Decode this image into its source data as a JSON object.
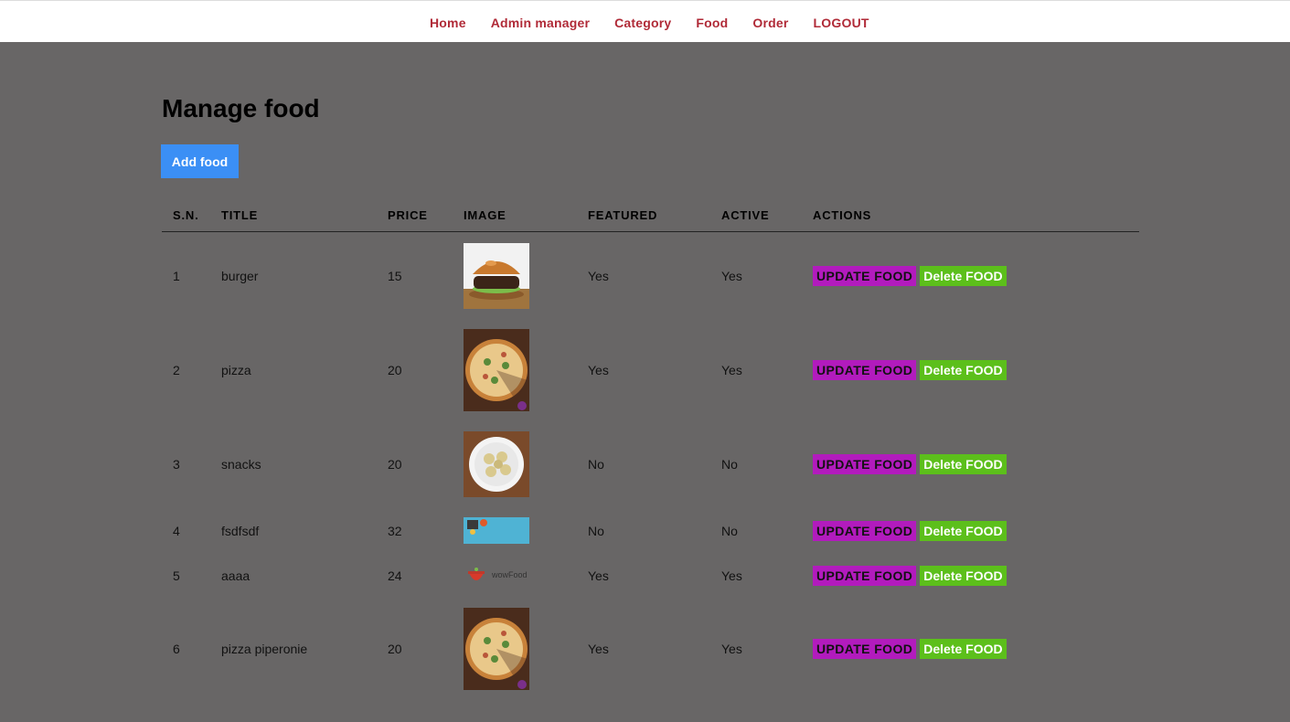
{
  "nav": {
    "items": [
      {
        "label": "Home"
      },
      {
        "label": "Admin manager"
      },
      {
        "label": "Category"
      },
      {
        "label": "Food"
      },
      {
        "label": "Order"
      },
      {
        "label": "LOGOUT"
      }
    ]
  },
  "page": {
    "title": "Manage food",
    "add_label": "Add food"
  },
  "table": {
    "headers": {
      "sn": "S.N.",
      "title": "TITLE",
      "price": "PRICE",
      "image": "IMAGE",
      "featured": "FEATURED",
      "active": "ACTIVE",
      "actions": "ACTIONS"
    },
    "update_label": "UPDATE FOOD",
    "delete_label": "Delete FOOD",
    "rows": [
      {
        "sn": "1",
        "title": "burger",
        "price": "15",
        "image": "burger-photo",
        "featured": "Yes",
        "active": "Yes"
      },
      {
        "sn": "2",
        "title": "pizza",
        "price": "20",
        "image": "pizza-photo",
        "featured": "Yes",
        "active": "Yes"
      },
      {
        "sn": "3",
        "title": "snacks",
        "price": "20",
        "image": "momo-photo",
        "featured": "No",
        "active": "No"
      },
      {
        "sn": "4",
        "title": "fsdfsdf",
        "price": "32",
        "image": "blue-banner",
        "featured": "No",
        "active": "No"
      },
      {
        "sn": "5",
        "title": "aaaa",
        "price": "24",
        "image": "wowfood-logo",
        "featured": "Yes",
        "active": "Yes",
        "image_text": "wowFood"
      },
      {
        "sn": "6",
        "title": "pizza piperonie",
        "price": "20",
        "image": "pizza-photo",
        "featured": "Yes",
        "active": "Yes"
      }
    ]
  },
  "colors": {
    "background": "#686666",
    "nav_link": "#b02a37",
    "add_button": "#3b8ff5",
    "update_button": "#b21bbd",
    "delete_button": "#5cbf1b"
  }
}
